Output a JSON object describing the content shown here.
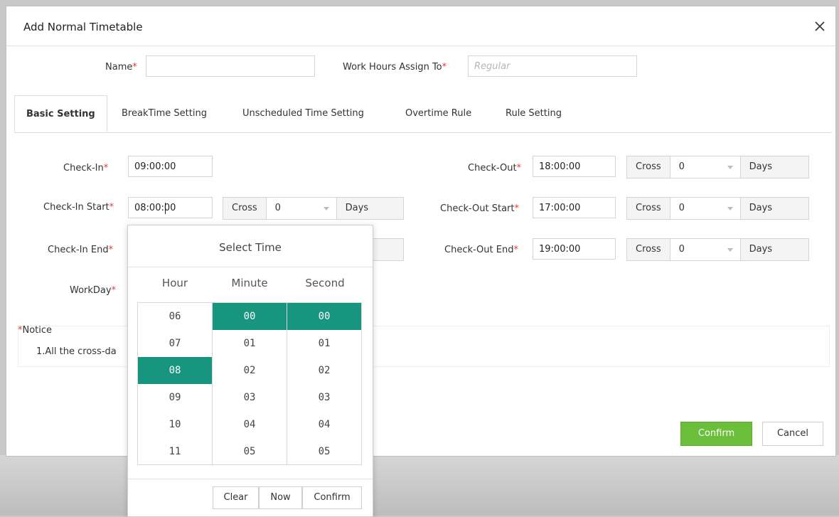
{
  "dialog": {
    "title": "Add Normal Timetable",
    "required_mark": "*"
  },
  "header_fields": {
    "name_label": "Name",
    "name_value": "",
    "assign_label": "Work Hours Assign To",
    "assign_placeholder": "Regular"
  },
  "tabs": [
    {
      "label": "Basic Setting",
      "active": true
    },
    {
      "label": "BreakTime Setting",
      "active": false
    },
    {
      "label": "Unscheduled Time Setting",
      "active": false
    },
    {
      "label": "Overtime Rule",
      "active": false
    },
    {
      "label": "Rule Setting",
      "active": false
    }
  ],
  "left_fields": {
    "check_in_label": "Check-In",
    "check_in_value": "09:00:00",
    "check_in_start_label": "Check-In Start",
    "check_in_start_value": "08:00:00",
    "check_in_start_cross": "Cross",
    "check_in_start_cross_days": "0",
    "check_in_start_days": "Days",
    "check_in_end_label": "Check-In End",
    "workday_label": "WorkDay"
  },
  "right_fields": {
    "check_out_label": "Check-Out",
    "check_out_value": "18:00:00",
    "check_out_cross": "Cross",
    "check_out_cross_days": "0",
    "check_out_days": "Days",
    "check_out_start_label": "Check-Out Start",
    "check_out_start_value": "17:00:00",
    "check_out_start_cross": "Cross",
    "check_out_start_cross_days": "0",
    "check_out_start_days": "Days",
    "check_out_end_label": "Check-Out End",
    "check_out_end_value": "19:00:00",
    "check_out_end_cross": "Cross",
    "check_out_end_cross_days": "0",
    "check_out_end_days": "Days"
  },
  "notice": {
    "title": "Notice",
    "text": "1.All the cross-da"
  },
  "footer": {
    "confirm": "Confirm",
    "cancel": "Cancel"
  },
  "picker": {
    "title": "Select Time",
    "hour_head": "Hour",
    "minute_head": "Minute",
    "second_head": "Second",
    "hours": [
      "06",
      "07",
      "08",
      "09",
      "10",
      "11"
    ],
    "minutes": [
      "00",
      "01",
      "02",
      "03",
      "04",
      "05"
    ],
    "seconds": [
      "00",
      "01",
      "02",
      "03",
      "04",
      "05"
    ],
    "selected_hour": "08",
    "selected_minute": "00",
    "selected_second": "00",
    "clear": "Clear",
    "now": "Now",
    "confirm": "Confirm"
  },
  "colors": {
    "accent_selected": "#18957f",
    "confirm_button": "#6bbf3a",
    "required": "#e23b3b"
  }
}
